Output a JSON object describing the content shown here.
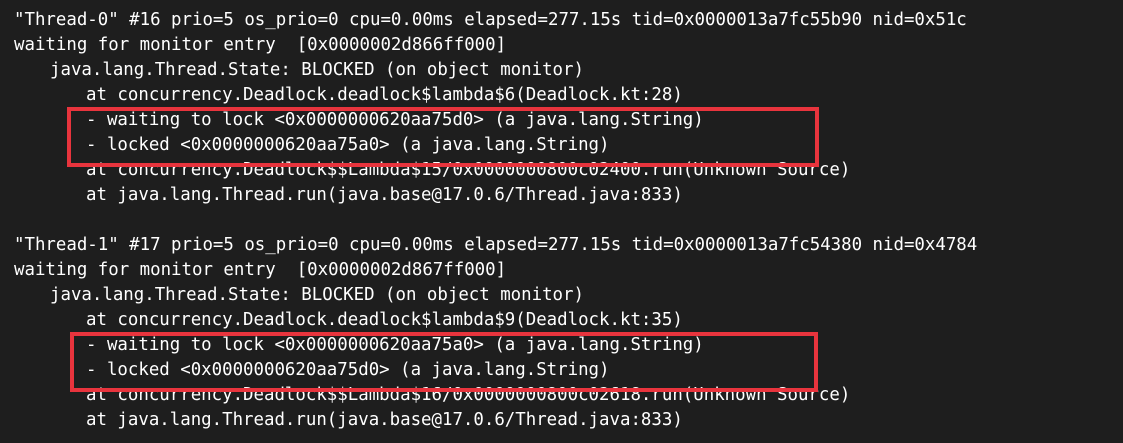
{
  "highlight_color": "#e8343d",
  "threads": [
    {
      "header": "\"Thread-0\" #16 prio=5 os_prio=0 cpu=0.00ms elapsed=277.15s tid=0x0000013a7fc55b90 nid=0x51c",
      "status": "waiting for monitor entry  [0x0000002d866ff000]",
      "state": "java.lang.Thread.State: BLOCKED (on object monitor)",
      "frame1": "at concurrency.Deadlock.deadlock$lambda$6(Deadlock.kt:28)",
      "waiting": "- waiting to lock <0x0000000620aa75d0> (a java.lang.String)",
      "locked": "- locked <0x0000000620aa75a0> (a java.lang.String)",
      "frame2": "at concurrency.Deadlock$$Lambda$15/0x0000000800c02400.run(Unknown Source)",
      "frame3": "at java.lang.Thread.run(java.base@17.0.6/Thread.java:833)"
    },
    {
      "header": "\"Thread-1\" #17 prio=5 os_prio=0 cpu=0.00ms elapsed=277.15s tid=0x0000013a7fc54380 nid=0x4784",
      "status": "waiting for monitor entry  [0x0000002d867ff000]",
      "state": "java.lang.Thread.State: BLOCKED (on object monitor)",
      "frame1": "at concurrency.Deadlock.deadlock$lambda$9(Deadlock.kt:35)",
      "waiting": "- waiting to lock <0x0000000620aa75a0> (a java.lang.String)",
      "locked": "- locked <0x0000000620aa75d0> (a java.lang.String)",
      "frame2": "at concurrency.Deadlock$$Lambda$16/0x0000000800c02618.run(Unknown Source)",
      "frame3": "at java.lang.Thread.run(java.base@17.0.6/Thread.java:833)"
    }
  ]
}
